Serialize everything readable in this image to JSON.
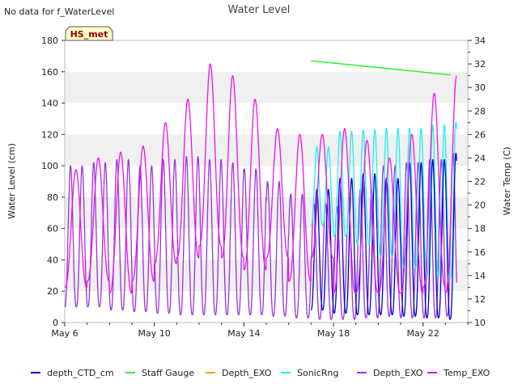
{
  "chart_data": {
    "type": "line",
    "title": "Water Level",
    "note": "No data for f_WaterLevel",
    "station_badge": "HS_met",
    "ylabel": "Water Level (cm)",
    "y2label": "Water Temp (C)",
    "ylim": [
      0,
      180
    ],
    "y2lim": [
      10,
      34
    ],
    "yticks": [
      0,
      20,
      40,
      60,
      80,
      100,
      120,
      140,
      160,
      180
    ],
    "y2ticks": [
      10,
      12,
      14,
      16,
      18,
      20,
      22,
      24,
      26,
      28,
      30,
      32,
      34
    ],
    "xlim": [
      "2024-05-06",
      "2024-05-24"
    ],
    "xticks": [
      {
        "value": "2024-05-06",
        "label": "May 6"
      },
      {
        "value": "2024-05-10",
        "label": "May 10"
      },
      {
        "value": "2024-05-14",
        "label": "May 14"
      },
      {
        "value": "2024-05-18",
        "label": "May 18"
      },
      {
        "value": "2024-05-22",
        "label": "May 22"
      }
    ],
    "legend_position": "bottom",
    "grid": "horizontal bands",
    "series": [
      {
        "name": "depth_CTD_cm",
        "axis": "left",
        "color": "#0000cc",
        "start": "2024-05-17T00:00",
        "end": "2024-05-23T12:00",
        "period_hours": 12.42,
        "low": [
          8,
          6,
          5,
          5,
          4,
          3,
          2,
          3
        ],
        "high": [
          85,
          92,
          95,
          92,
          102,
          104,
          108,
          110
        ]
      },
      {
        "name": "Staff Gauge",
        "axis": "left",
        "color": "#33ee33",
        "points": [
          [
            "2024-05-17T00:00",
            167
          ],
          [
            "2024-05-23T06:00",
            158
          ]
        ]
      },
      {
        "name": "Depth_EXO",
        "axis": "left",
        "color": "#ff9900",
        "points": []
      },
      {
        "name": "SonicRng",
        "axis": "left",
        "color": "#22eeee",
        "start": "2024-05-17T00:00",
        "end": "2024-05-23T12:00",
        "period_hours": 12.42,
        "low": [
          62,
          55,
          50,
          42,
          35,
          30,
          28,
          40
        ],
        "high": [
          112,
          122,
          123,
          124,
          124,
          126,
          128,
          116
        ]
      },
      {
        "name": "Depth_EXO",
        "axis": "left",
        "color": "#9933dd",
        "start": "2024-05-06T00:00",
        "end": "2024-05-23T12:00",
        "period_hours": 12.42,
        "low": [
          10,
          10,
          8,
          7,
          6,
          5,
          5,
          5,
          5,
          4,
          3,
          2,
          2,
          3,
          4,
          3,
          3,
          4
        ],
        "high": [
          100,
          102,
          104,
          100,
          104,
          106,
          104,
          102,
          98,
          90,
          82,
          76,
          74,
          85,
          100,
          102,
          104,
          108
        ]
      },
      {
        "name": "Temp_EXO",
        "axis": "right",
        "color": "#ee11ee",
        "start": "2024-05-06T00:00",
        "end": "2024-05-23T12:00",
        "period_hours": 24,
        "low": [
          13,
          13.5,
          12.5,
          13.5,
          15,
          15.5,
          16.5,
          15.5,
          14.5,
          15.5,
          13.5,
          15.5,
          12.5,
          12.5,
          12.5,
          12.5,
          13,
          12.5
        ],
        "high": [
          23,
          24,
          24.5,
          25,
          27,
          29,
          32,
          31,
          29,
          26.5,
          26,
          26,
          26.5,
          25.5,
          24,
          26,
          29.5,
          31
        ]
      }
    ]
  }
}
